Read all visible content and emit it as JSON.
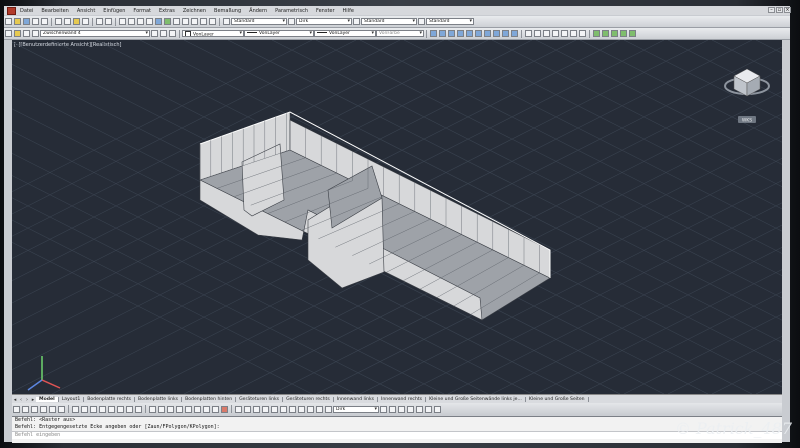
{
  "menubar": {
    "items": [
      "Datei",
      "Bearbeiten",
      "Ansicht",
      "Einfügen",
      "Format",
      "Extras",
      "Zeichnen",
      "Bemaßung",
      "Ändern",
      "Parametrisch",
      "Fenster",
      "Hilfe"
    ]
  },
  "toolbar1": {
    "text_style": "Standard",
    "dim_style": "Dirk",
    "table_style": "Standard",
    "multileader_style": "Standard"
  },
  "toolbar2": {
    "layer": "Zwischenwand 4",
    "color": "VonLayer",
    "linetype": "VonLayer",
    "lineweight": "VonLayer",
    "plotstyle": "VonFarbe"
  },
  "viewport": {
    "label": "[–][Benutzerdefinierte Ansicht][Realistisch]",
    "wcs_label": "WKS",
    "colors": {
      "background": "#262c37",
      "grid": "#3a4350",
      "model_face": "#d7d8da",
      "model_shade": "#9ea2a8"
    }
  },
  "layout_tabs": [
    "Model",
    "Layout1",
    "Bodenplatte rechts",
    "Bodenplatte links",
    "Bodenplatten hinten",
    "Geräteturen links",
    "Geräteturen rechts",
    "Innenwand links",
    "Innenwand rechts",
    "Kleine und Große Seitenwände links je...",
    "Kleine und Große Seiten"
  ],
  "statusbar": {
    "visual_style": "Dirk"
  },
  "command": {
    "lines": [
      "Befehl: <Raster aus>",
      "Befehl: Entgegengesetzte Ecke angeben oder [Zaun/FPolygon/KPolygon]:"
    ],
    "placeholder": "Befehl eingeben"
  },
  "watermark": "© Patrick_487"
}
